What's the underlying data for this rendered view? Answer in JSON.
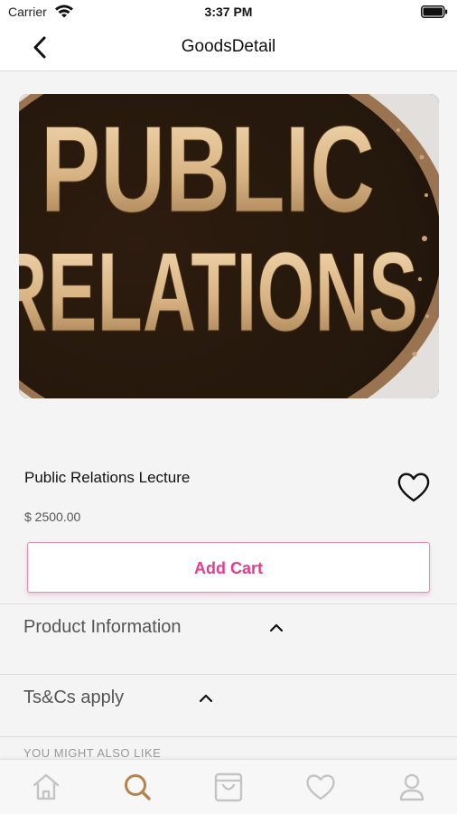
{
  "status_bar": {
    "carrier": "Carrier",
    "time": "3:37 PM"
  },
  "nav": {
    "title": "GoodsDetail",
    "back_icon": "chevron-left-icon"
  },
  "product": {
    "image_text_line1": "PUBLIC",
    "image_text_line2": "RELATIONS",
    "name": "Public Relations Lecture",
    "price": "$ 2500.00",
    "favorite_icon": "heart-outline-icon"
  },
  "actions": {
    "add_cart_label": "Add Cart"
  },
  "sections": [
    {
      "label": "Product Information",
      "icon": "chevron-up-icon"
    },
    {
      "label": "Ts&Cs apply",
      "icon": "chevron-up-icon"
    }
  ],
  "recommendations": {
    "heading": "YOU MIGHT ALSO LIKE"
  },
  "tab_bar": [
    {
      "name": "home",
      "icon": "home-icon",
      "active": false
    },
    {
      "name": "search",
      "icon": "search-icon",
      "active": true
    },
    {
      "name": "cart",
      "icon": "shopping-bag-icon",
      "active": false
    },
    {
      "name": "favorites",
      "icon": "heart-icon",
      "active": false
    },
    {
      "name": "profile",
      "icon": "user-icon",
      "active": false
    }
  ],
  "colors": {
    "accent_pink": "#e63c8c",
    "tab_active": "#b8834a",
    "tab_inactive": "#c4c4c4",
    "background": "#f4f4f4"
  }
}
